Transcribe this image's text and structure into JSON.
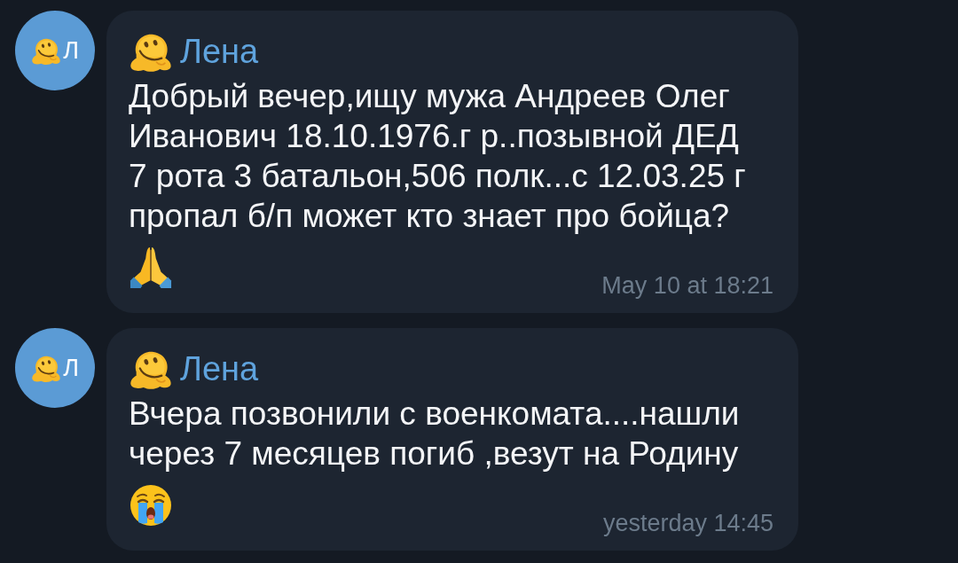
{
  "messages": [
    {
      "avatar": {
        "initial": "Л"
      },
      "sender": "Лена",
      "lines": [
        "Добрый вечер,ищу мужа Андреев Олег",
        "Иванович 18.10.1976.г р..позывной ДЕД",
        "7 рота 3 батальон,506 полк...с 12.03.25 г",
        "пропал б/п может кто знает про бойца?"
      ],
      "emoji": {
        "kind": "folded-hands"
      },
      "time": "May 10 at 18:21"
    },
    {
      "avatar": {
        "initial": "Л"
      },
      "sender": "Лена",
      "lines": [
        "Вчера позвонили с военкомата....нашли",
        "через 7 месяцев погиб ,везут на Родину"
      ],
      "emoji": {
        "kind": "crying-face"
      },
      "time": "yesterday 14:45"
    }
  ]
}
